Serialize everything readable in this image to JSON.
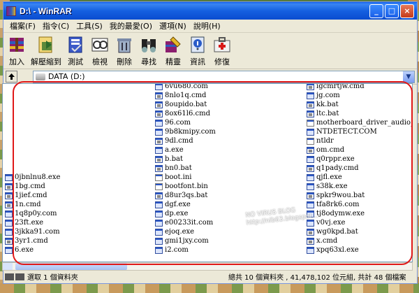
{
  "window": {
    "title": "D:\\ - WinRAR",
    "btn_min": "_",
    "btn_max": "□",
    "btn_close": "×"
  },
  "menu": [
    "檔案(F)",
    "指令(C)",
    "工具(S)",
    "我的最愛(O)",
    "選項(N)",
    "說明(H)"
  ],
  "toolbar": [
    {
      "label": "加入",
      "icon": "add-archive-icon"
    },
    {
      "label": "解壓縮到",
      "icon": "extract-icon"
    },
    {
      "label": "測試",
      "icon": "test-icon"
    },
    {
      "label": "檢視",
      "icon": "view-icon"
    },
    {
      "label": "刪除",
      "icon": "delete-icon"
    },
    {
      "label": "尋找",
      "icon": "find-icon"
    },
    {
      "label": "精靈",
      "icon": "wizard-icon"
    },
    {
      "label": "資訊",
      "icon": "info-icon"
    },
    {
      "label": "修復",
      "icon": "repair-icon"
    }
  ],
  "address": {
    "path": "DATA (D:)",
    "up_icon": "up-arrow-icon",
    "dropdown_icon": "chevron-down-icon"
  },
  "files": {
    "col1": [
      "0jbnlnu8.exe",
      "1bg.cmd",
      "1jief.cmd",
      "1n.cmd",
      "1q8p0y.com",
      "23ft.exe",
      "3jkka91.com",
      "3yr1.cmd",
      "6.exe"
    ],
    "col2": [
      "6vu680.com",
      "8nlo1q.cmd",
      "8oupido.bat",
      "8ox61l6.cmd",
      "96.com",
      "9b8kmipy.com",
      "9dl.cmd",
      "a.exe",
      "b.bat",
      "bn0.bat",
      "boot.ini",
      "bootfont.bin",
      "d8ur3qs.bat",
      "dgf.exe",
      "dp.exe",
      "e00233it.com",
      "ejoq.exe",
      "gmi1jxy.com",
      "i2.com"
    ],
    "col3": [
      "igcmrtjw.cmd",
      "jg.com",
      "kk.bat",
      "ltc.bat",
      "motherboard_driver_audio_",
      "NTDETECT.COM",
      "ntldr",
      "om.cmd",
      "q0rppr.exe",
      "q1pady.cmd",
      "qjfl.exe",
      "s38k.exe",
      "spkr9wou.bat",
      "tfa8rk6.com",
      "tj8odymw.exe",
      "v0vj.exe",
      "wg0kpd.bat",
      "x.cmd",
      "xpq63xl.exe"
    ]
  },
  "status": {
    "left": "選取 1 個資料夾",
    "right": "總共 10 個資料夾 , 41,478,102 位元組, 共計 48 個檔案"
  },
  "watermark": {
    "line1": "NO VIRUS BLOG",
    "line2": "http://nib63.blogspot..."
  },
  "colors": {
    "title_blue": "#0a5ae6",
    "highlight_red": "#e01818"
  }
}
